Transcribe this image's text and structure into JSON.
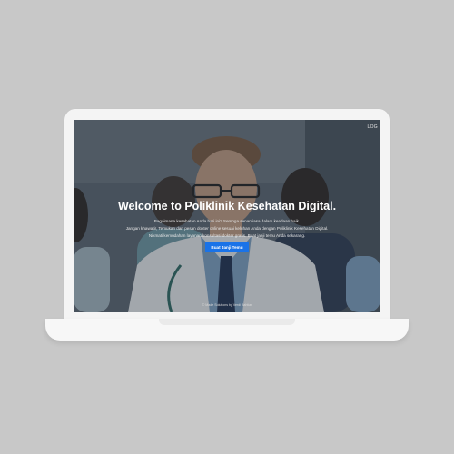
{
  "screen": {
    "corner_text": "LOG",
    "hero_title": "Welcome to Poliklinik Kesehatan Digital.",
    "hero_lines": [
      "Bagaimana kesehatan Anda hari ini? Semoga senantiasa dalam keadaan baik.",
      "Jangan khawatir, Temukan dan pesan dokter online sesuai keluhan Anda dengan Poliklinik Kesehatan Digital.",
      "Nikmati kemudahan layanan konsultasi dokter gratis. Buat janji temu Anda sekarang."
    ],
    "cta_label": "Buat Janji Temu",
    "footer_note": "© Made Solutions by Verdi Bahtiar"
  },
  "colors": {
    "cta": "#1a73e8",
    "laptop_body": "#f4f4f4",
    "backdrop": "#c8c8c8"
  }
}
